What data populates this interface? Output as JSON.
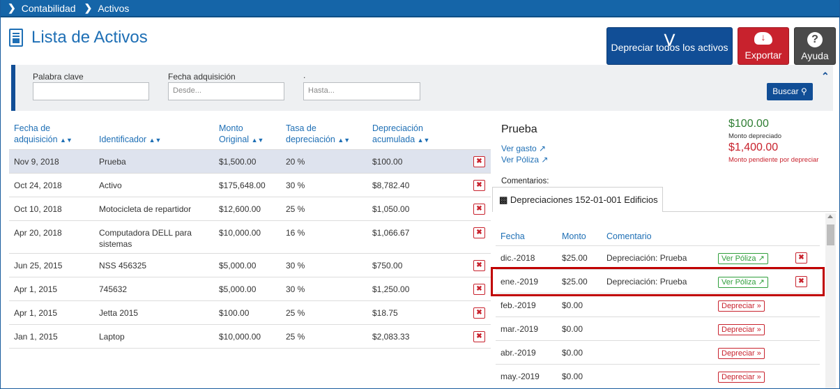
{
  "breadcrumb": [
    "Contabilidad",
    "Activos"
  ],
  "page": {
    "title": "Lista de Activos"
  },
  "toolbar": {
    "depreciate_all": "Depreciar todos los activos",
    "export": "Exportar",
    "help": "Ayuda"
  },
  "filters": {
    "keyword_label": "Palabra clave",
    "keyword_value": "",
    "date_label": "Fecha adquisición",
    "date_to_label": ".",
    "from_placeholder": "Desde...",
    "to_placeholder": "Hasta...",
    "search": "Buscar"
  },
  "table": {
    "headers": {
      "date": [
        "Fecha de",
        "adquisición"
      ],
      "id": [
        "Identificador"
      ],
      "amount": [
        "Monto",
        "Original"
      ],
      "rate": [
        "Tasa de",
        "depreciación"
      ],
      "dep": [
        "Depreciación",
        "acumulada"
      ]
    },
    "rows": [
      {
        "date": "Nov 9, 2018",
        "id": "Prueba",
        "amount": "$1,500.00",
        "rate": "20 %",
        "dep": "$100.00",
        "selected": true
      },
      {
        "date": "Oct 24, 2018",
        "id": "Activo",
        "amount": "$175,648.00",
        "rate": "30 %",
        "dep": "$8,782.40"
      },
      {
        "date": "Oct 10, 2018",
        "id": "Motocicleta de repartidor",
        "amount": "$12,600.00",
        "rate": "25 %",
        "dep": "$1,050.00"
      },
      {
        "date": "Apr 20, 2018",
        "id": "Computadora DELL para sistemas",
        "amount": "$10,000.00",
        "rate": "16 %",
        "dep": "$1,066.67"
      },
      {
        "date": "Jun 25, 2015",
        "id": "NSS 456325",
        "amount": "$5,000.00",
        "rate": "30 %",
        "dep": "$750.00"
      },
      {
        "date": "Apr 1, 2015",
        "id": "745632",
        "amount": "$5,000.00",
        "rate": "30 %",
        "dep": "$1,250.00"
      },
      {
        "date": "Apr 1, 2015",
        "id": "Jetta 2015",
        "amount": "$100.00",
        "rate": "25 %",
        "dep": "$18.75"
      },
      {
        "date": "Jan 1, 2015",
        "id": "Laptop",
        "amount": "$10,000.00",
        "rate": "25 %",
        "dep": "$2,083.33"
      }
    ]
  },
  "detail": {
    "name": "Prueba",
    "ver_gasto": "Ver gasto",
    "ver_poliza": "Ver Póliza",
    "depreciated_amount": "$100.00",
    "depreciated_label": "Monto depreciado",
    "pending_amount": "$1,400.00",
    "pending_label": "Monto pendiente por depreciar",
    "comments_label": "Comentarios:",
    "tab_label": "Depreciaciones 152-01-001 Edificios",
    "sub_headers": {
      "date": "Fecha",
      "amount": "Monto",
      "comment": "Comentario"
    },
    "rows": [
      {
        "date": "dic.-2018",
        "amount": "$25.00",
        "comment": "Depreciación: Prueba",
        "action": "Ver Póliza",
        "kind": "poliza"
      },
      {
        "date": "ene.-2019",
        "amount": "$25.00",
        "comment": "Depreciación: Prueba",
        "action": "Ver Póliza",
        "kind": "poliza"
      },
      {
        "date": "feb.-2019",
        "amount": "$0.00",
        "comment": "",
        "action": "Depreciar",
        "kind": "depreciar"
      },
      {
        "date": "mar.-2019",
        "amount": "$0.00",
        "comment": "",
        "action": "Depreciar",
        "kind": "depreciar"
      },
      {
        "date": "abr.-2019",
        "amount": "$0.00",
        "comment": "",
        "action": "Depreciar",
        "kind": "depreciar"
      },
      {
        "date": "may.-2019",
        "amount": "$0.00",
        "comment": "",
        "action": "Depreciar",
        "kind": "depreciar"
      }
    ]
  },
  "colors": {
    "primary": "#114e96",
    "danger": "#c8222d",
    "success": "#2e9e3a",
    "highlight": "#c00000"
  }
}
